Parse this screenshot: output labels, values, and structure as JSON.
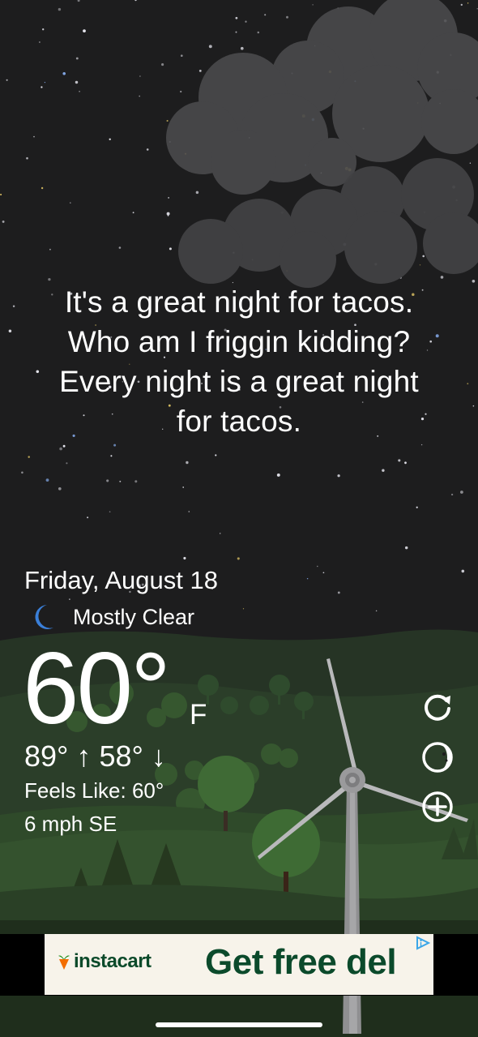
{
  "quote": {
    "lines": [
      "It's a great night for tacos.",
      "Who am I friggin kidding?",
      "Every night is a great night",
      "for tacos."
    ]
  },
  "weather": {
    "date": "Friday, August 18",
    "condition": "Mostly Clear",
    "condition_icon": "moon-icon",
    "temperature": "60°",
    "unit": "F",
    "high": "89°",
    "low": "58°",
    "feels_like": "Feels Like: 60°",
    "wind": "6 mph SE"
  },
  "controls": [
    {
      "name": "refresh-icon"
    },
    {
      "name": "moon-phase-icon"
    },
    {
      "name": "add-location-icon"
    }
  ],
  "ad": {
    "brand": "instacart",
    "slogan": "Get free del",
    "adchoices_icon": "adchoices-icon",
    "bg_color": "#f7f3ea",
    "text_color": "#0b4a2b"
  },
  "colors": {
    "sky": "#1d1d1e",
    "hills": "#2f4a2c",
    "moon_icon": "#3a7fd8"
  }
}
